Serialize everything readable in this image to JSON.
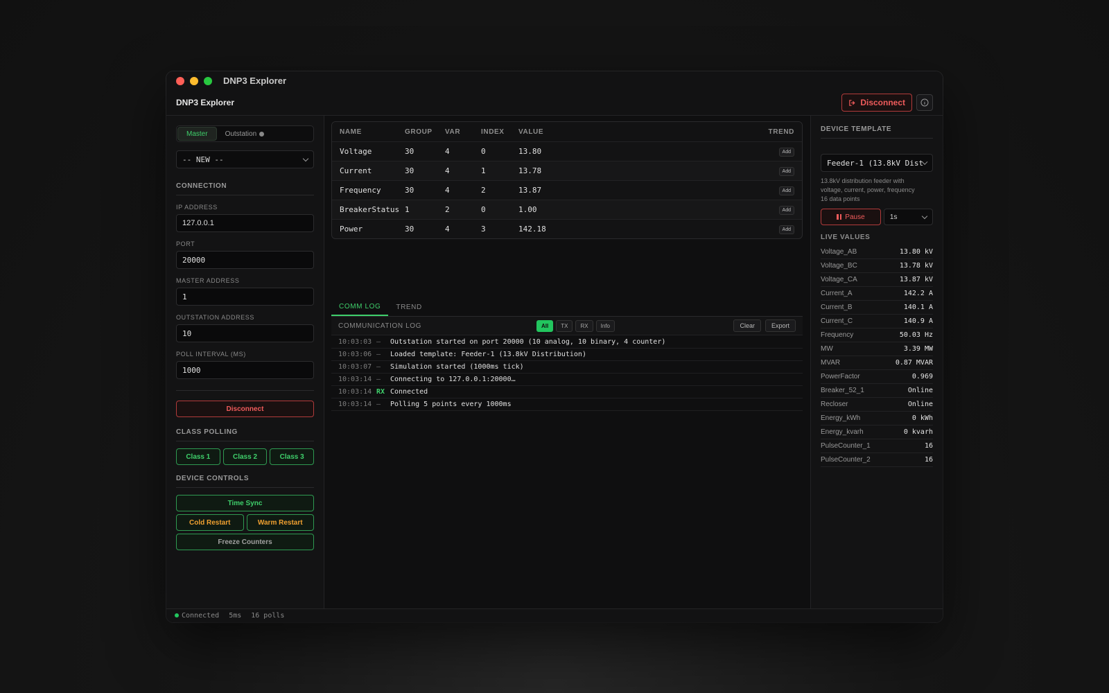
{
  "window": {
    "title": "DNP3 Explorer"
  },
  "header": {
    "app_name": "DNP3 Explorer",
    "disconnect_label": "Disconnect"
  },
  "left": {
    "mode_tabs": [
      {
        "label": "Master",
        "active": true
      },
      {
        "label": "Outstation",
        "active": false
      }
    ],
    "session_select": "-- NEW --",
    "connection_title": "CONNECTION",
    "fields": [
      {
        "label": "IP ADDRESS",
        "value": "127.0.0.1"
      },
      {
        "label": "PORT",
        "value": "20000"
      },
      {
        "label": "MASTER ADDRESS",
        "value": "1"
      },
      {
        "label": "OUTSTATION ADDRESS",
        "value": "10"
      },
      {
        "label": "POLL INTERVAL (MS)",
        "value": "1000"
      }
    ],
    "disconnect_label": "Disconnect",
    "class_polling_title": "CLASS POLLING",
    "class_buttons": [
      "Class 1",
      "Class 2",
      "Class 3"
    ],
    "device_controls_title": "DEVICE CONTROLS",
    "time_sync_label": "Time Sync",
    "cold_restart_label": "Cold Restart",
    "warm_restart_label": "Warm Restart",
    "freeze_counters_label": "Freeze Counters"
  },
  "points_table": {
    "headers": {
      "name": "NAME",
      "group": "GROUP",
      "var": "VAR",
      "index": "INDEX",
      "value": "VALUE",
      "trend": "TREND"
    },
    "add_label": "Add",
    "rows": [
      {
        "name": "Voltage",
        "group": "30",
        "var": "4",
        "index": "0",
        "value": "13.80"
      },
      {
        "name": "Current",
        "group": "30",
        "var": "4",
        "index": "1",
        "value": "13.78"
      },
      {
        "name": "Frequency",
        "group": "30",
        "var": "4",
        "index": "2",
        "value": "13.87"
      },
      {
        "name": "BreakerStatus",
        "group": "1",
        "var": "2",
        "index": "0",
        "value": "1.00"
      },
      {
        "name": "Power",
        "group": "30",
        "var": "4",
        "index": "3",
        "value": "142.18"
      }
    ]
  },
  "log": {
    "tabs": [
      {
        "label": "COMM LOG",
        "active": true
      },
      {
        "label": "TREND",
        "active": false
      }
    ],
    "title": "COMMUNICATION LOG",
    "filters": [
      "All",
      "TX",
      "RX",
      "Info"
    ],
    "clear_label": "Clear",
    "export_label": "Export",
    "entries": [
      {
        "time": "10:03:03",
        "dir": "—",
        "message": "Outstation started on port 20000 (10 analog, 10 binary, 4 counter)"
      },
      {
        "time": "10:03:06",
        "dir": "—",
        "message": "Loaded template: Feeder-1 (13.8kV Distribution)"
      },
      {
        "time": "10:03:07",
        "dir": "—",
        "message": "Simulation started (1000ms tick)"
      },
      {
        "time": "10:03:14",
        "dir": "—",
        "message": "Connecting to 127.0.0.1:20000…"
      },
      {
        "time": "10:03:14",
        "dir": "RX",
        "message": "Connected"
      },
      {
        "time": "10:03:14",
        "dir": "—",
        "message": "Polling 5 points every 1000ms"
      }
    ]
  },
  "right": {
    "template_title": "DEVICE TEMPLATE",
    "template_select": "Feeder-1 (13.8kV Dist",
    "template_desc_1": "13.8kV distribution feeder with",
    "template_desc_2": "voltage, current, power, frequency",
    "template_desc_3": "16 data points",
    "pause_label": "Pause",
    "interval": "1s",
    "live_title": "LIVE VALUES",
    "live_values": [
      {
        "name": "Voltage_AB",
        "value": "13.80 kV"
      },
      {
        "name": "Voltage_BC",
        "value": "13.78 kV"
      },
      {
        "name": "Voltage_CA",
        "value": "13.87 kV"
      },
      {
        "name": "Current_A",
        "value": "142.2 A"
      },
      {
        "name": "Current_B",
        "value": "140.1 A"
      },
      {
        "name": "Current_C",
        "value": "140.9 A"
      },
      {
        "name": "Frequency",
        "value": "50.03 Hz"
      },
      {
        "name": "MW",
        "value": "3.39 MW"
      },
      {
        "name": "MVAR",
        "value": "0.87 MVAR"
      },
      {
        "name": "PowerFactor",
        "value": "0.969"
      },
      {
        "name": "Breaker_52_1",
        "value": "Online"
      },
      {
        "name": "Recloser",
        "value": "Online"
      },
      {
        "name": "Energy_kWh",
        "value": "0 kWh"
      },
      {
        "name": "Energy_kvarh",
        "value": "0 kvarh"
      },
      {
        "name": "PulseCounter_1",
        "value": "16"
      },
      {
        "name": "PulseCounter_2",
        "value": "16"
      }
    ]
  },
  "status": {
    "state": "Connected",
    "latency": "5ms",
    "polls": "16 polls"
  },
  "colors": {
    "accent": "#22c55e",
    "danger": "#ef5b5b",
    "warning": "#f0a030",
    "background": "#0e0e0f"
  }
}
